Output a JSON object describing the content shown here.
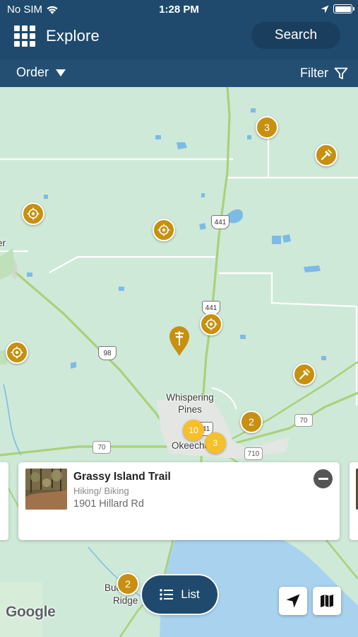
{
  "status_bar": {
    "carrier": "No SIM",
    "time": "1:28 PM",
    "battery_level": 1.0
  },
  "nav": {
    "title": "Explore",
    "search_label": "Search"
  },
  "filter_bar": {
    "order_label": "Order",
    "filter_label": "Filter"
  },
  "map": {
    "place_labels": {
      "edge_left": "er",
      "whispering_pines": "Whispering\nPines",
      "okeechobee": "Okeechobee",
      "buckhead_ridge_top": "Buc",
      "buckhead_ridge_bottom": "Ridge"
    },
    "route_shields": {
      "us441_north": "441",
      "us441_south": "441",
      "sr98": "98",
      "sr70_west": "70",
      "sr70_east": "70",
      "sr710": "710",
      "us441_town": "441"
    },
    "clusters": {
      "north": "3",
      "east_okeechobee": "2",
      "town_a": "10",
      "town_b": "3",
      "south": "2"
    },
    "colors": {
      "land": "#cfe9d8",
      "water": "#a9d2ef",
      "road": "#ffffff",
      "highway": "#a8d27a",
      "marker": "#c7900f",
      "cluster_small": "#f6c02b"
    },
    "attribution": "Google"
  },
  "card": {
    "title": "Grassy Island Trail",
    "subtitle": "Hiking/ Biking",
    "address": "1901 Hillard Rd"
  },
  "controls": {
    "list_label": "List"
  }
}
